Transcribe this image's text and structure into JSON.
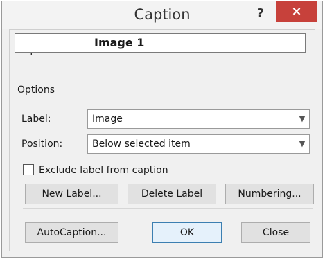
{
  "window": {
    "title": "Caption",
    "help_label": "?",
    "close_label": "×"
  },
  "caption": {
    "label": "Caption:",
    "value": "Image 1"
  },
  "options": {
    "heading": "Options",
    "label_field": {
      "label": "Label:",
      "value": "Image"
    },
    "position_field": {
      "label": "Position:",
      "value": "Below selected item"
    },
    "exclude_checkbox": {
      "label": "Exclude label from caption",
      "checked": false
    }
  },
  "buttons": {
    "new_label": "New Label...",
    "delete_label": "Delete Label",
    "numbering": "Numbering...",
    "autocaption": "AutoCaption...",
    "ok": "OK",
    "close": "Close"
  },
  "icons": {
    "dropdown": "chevron-down-icon",
    "close": "close-icon",
    "help": "help-icon"
  }
}
